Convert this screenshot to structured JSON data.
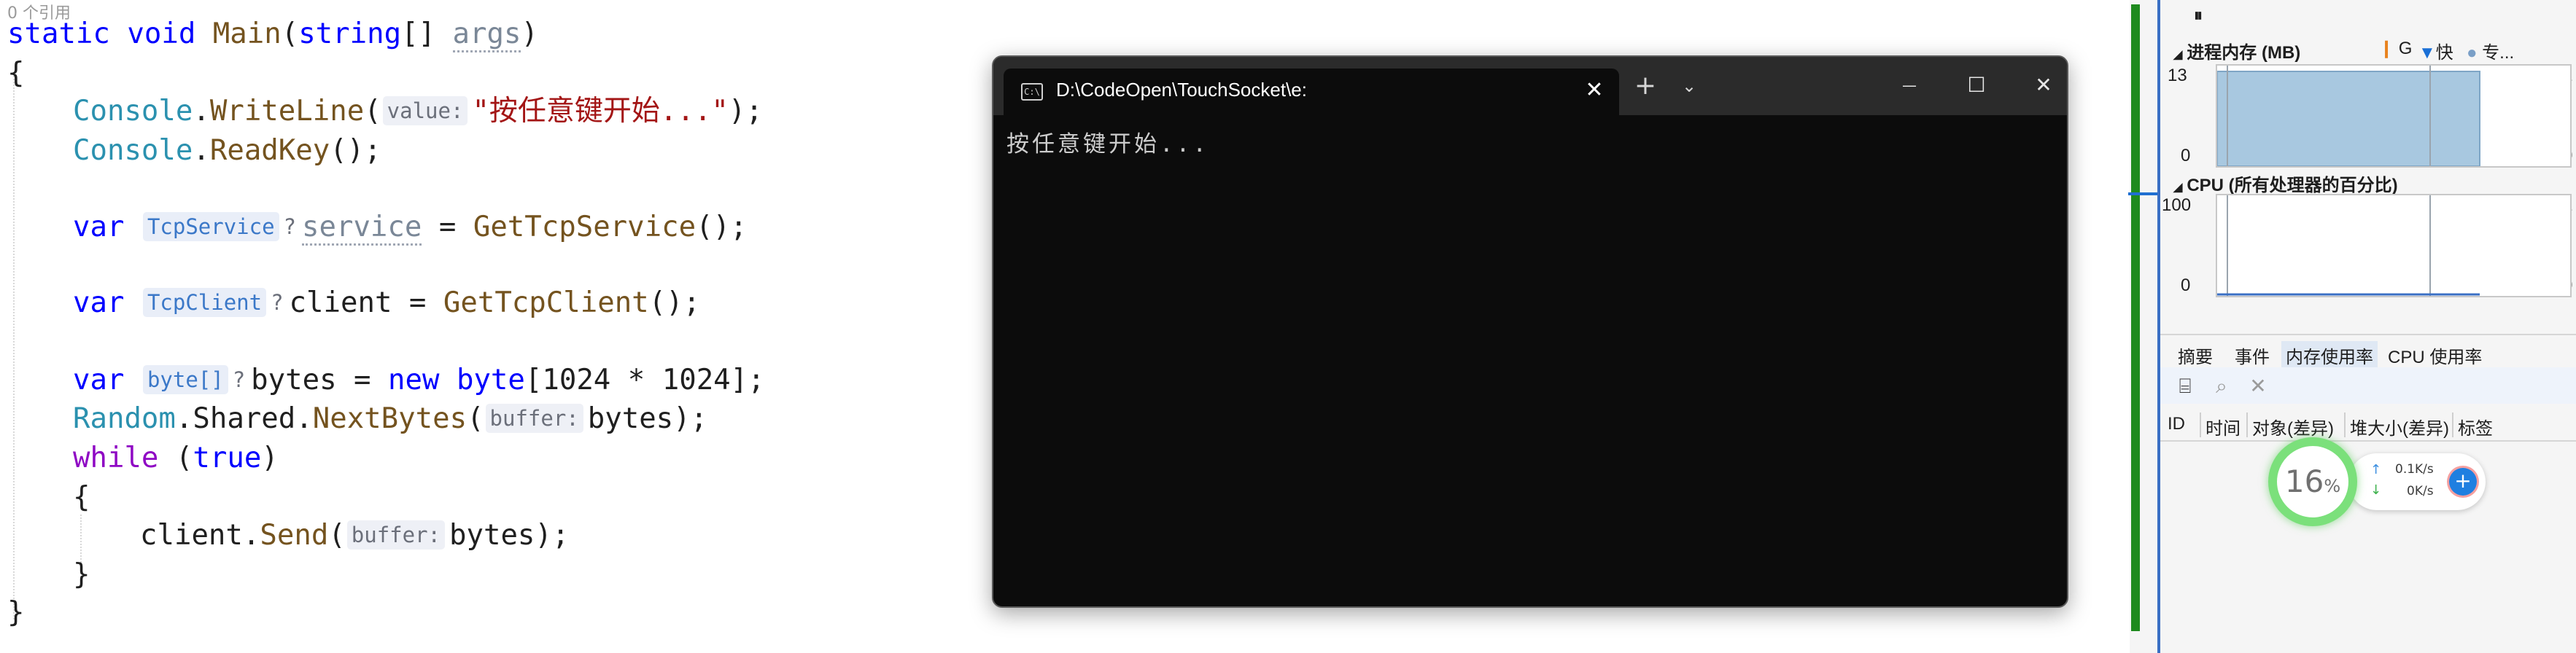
{
  "editor": {
    "ref_hint": "0 个引用",
    "line1": {
      "kw_static": "static",
      "kw_void": "void",
      "name": "Main",
      "open": "(",
      "kw_string": "string",
      "brackets": "[] ",
      "param": "args",
      "close": ")"
    },
    "line2": "{",
    "line3": {
      "type": "Console",
      "dot": ".",
      "method": "WriteLine",
      "open": "(",
      "hint": "value:",
      "str": "\"按任意键开始...\"",
      "end": ");"
    },
    "line4": {
      "type": "Console",
      "dot": ".",
      "method": "ReadKey",
      "end": "();"
    },
    "line5": {
      "kw": "var",
      "type_hint": "TcpService",
      "q": "?",
      "name": "service",
      "eq": " = ",
      "method": "GetTcpService",
      "end": "();"
    },
    "line6": {
      "kw": "var",
      "type_hint": "TcpClient",
      "q": "?",
      "name": "client",
      "eq": " = ",
      "method": "GetTcpClient",
      "end": "();"
    },
    "line7": {
      "kw": "var",
      "type_hint": "byte[]",
      "q": "?",
      "name": "bytes",
      "eq": " = ",
      "kw_new": "new",
      "kw_byte": "byte",
      "expr": "[1024 * 1024];"
    },
    "line8": {
      "type": "Random",
      "mid": ".Shared.",
      "method": "NextBytes",
      "open": "(",
      "hint": "buffer:",
      "arg": "bytes",
      "end": ");"
    },
    "line9": {
      "kw": "while",
      "open": " (",
      "kw_true": "true",
      "close": ")"
    },
    "line10": "{",
    "line11": {
      "obj": "client",
      "dot": ".",
      "method": "Send",
      "open": "(",
      "hint": "buffer:",
      "arg": "bytes",
      "end": ");"
    },
    "line12": "}",
    "line13": "}"
  },
  "console": {
    "tab_title": "D:\\CodeOpen\\TouchSocket\\e:",
    "tab_icon": "C:\\",
    "close_tab": "✕",
    "new_tab": "+",
    "dropdown": "⌄",
    "minimize": "—",
    "maximize": "☐",
    "close": "✕",
    "output": "按任意键开始..."
  },
  "diagnostics": {
    "pause": "⏸",
    "mem_title": "进程内存 (MB)",
    "legend": {
      "gc": "G",
      "snapshot": "快",
      "private": "专..."
    },
    "mem_chart": {
      "max_left": "13",
      "min_left": "0",
      "max_right": "1",
      "min_right": "0"
    },
    "cpu_title": "CPU (所有处理器的百分比)",
    "cpu_chart": {
      "max_left": "100",
      "min_left": "0",
      "max_right": "1",
      "min_right": "0"
    },
    "tabs": [
      "摘要",
      "事件",
      "内存使用率",
      "CPU 使用率"
    ],
    "columns": [
      "ID",
      "时间",
      "对象(差异)",
      "堆大小(差异)",
      "标签"
    ],
    "colors": {
      "accent": "#1e8a1e",
      "mem_fill": "#a8c8e0",
      "cpu_line": "#3a6fc4"
    }
  },
  "widget": {
    "percent": "16",
    "percent_sign": "%",
    "upload": "0.1K/s",
    "download": "0K/s",
    "up_arrow": "↑",
    "down_arrow": "↓",
    "plus": "+"
  }
}
